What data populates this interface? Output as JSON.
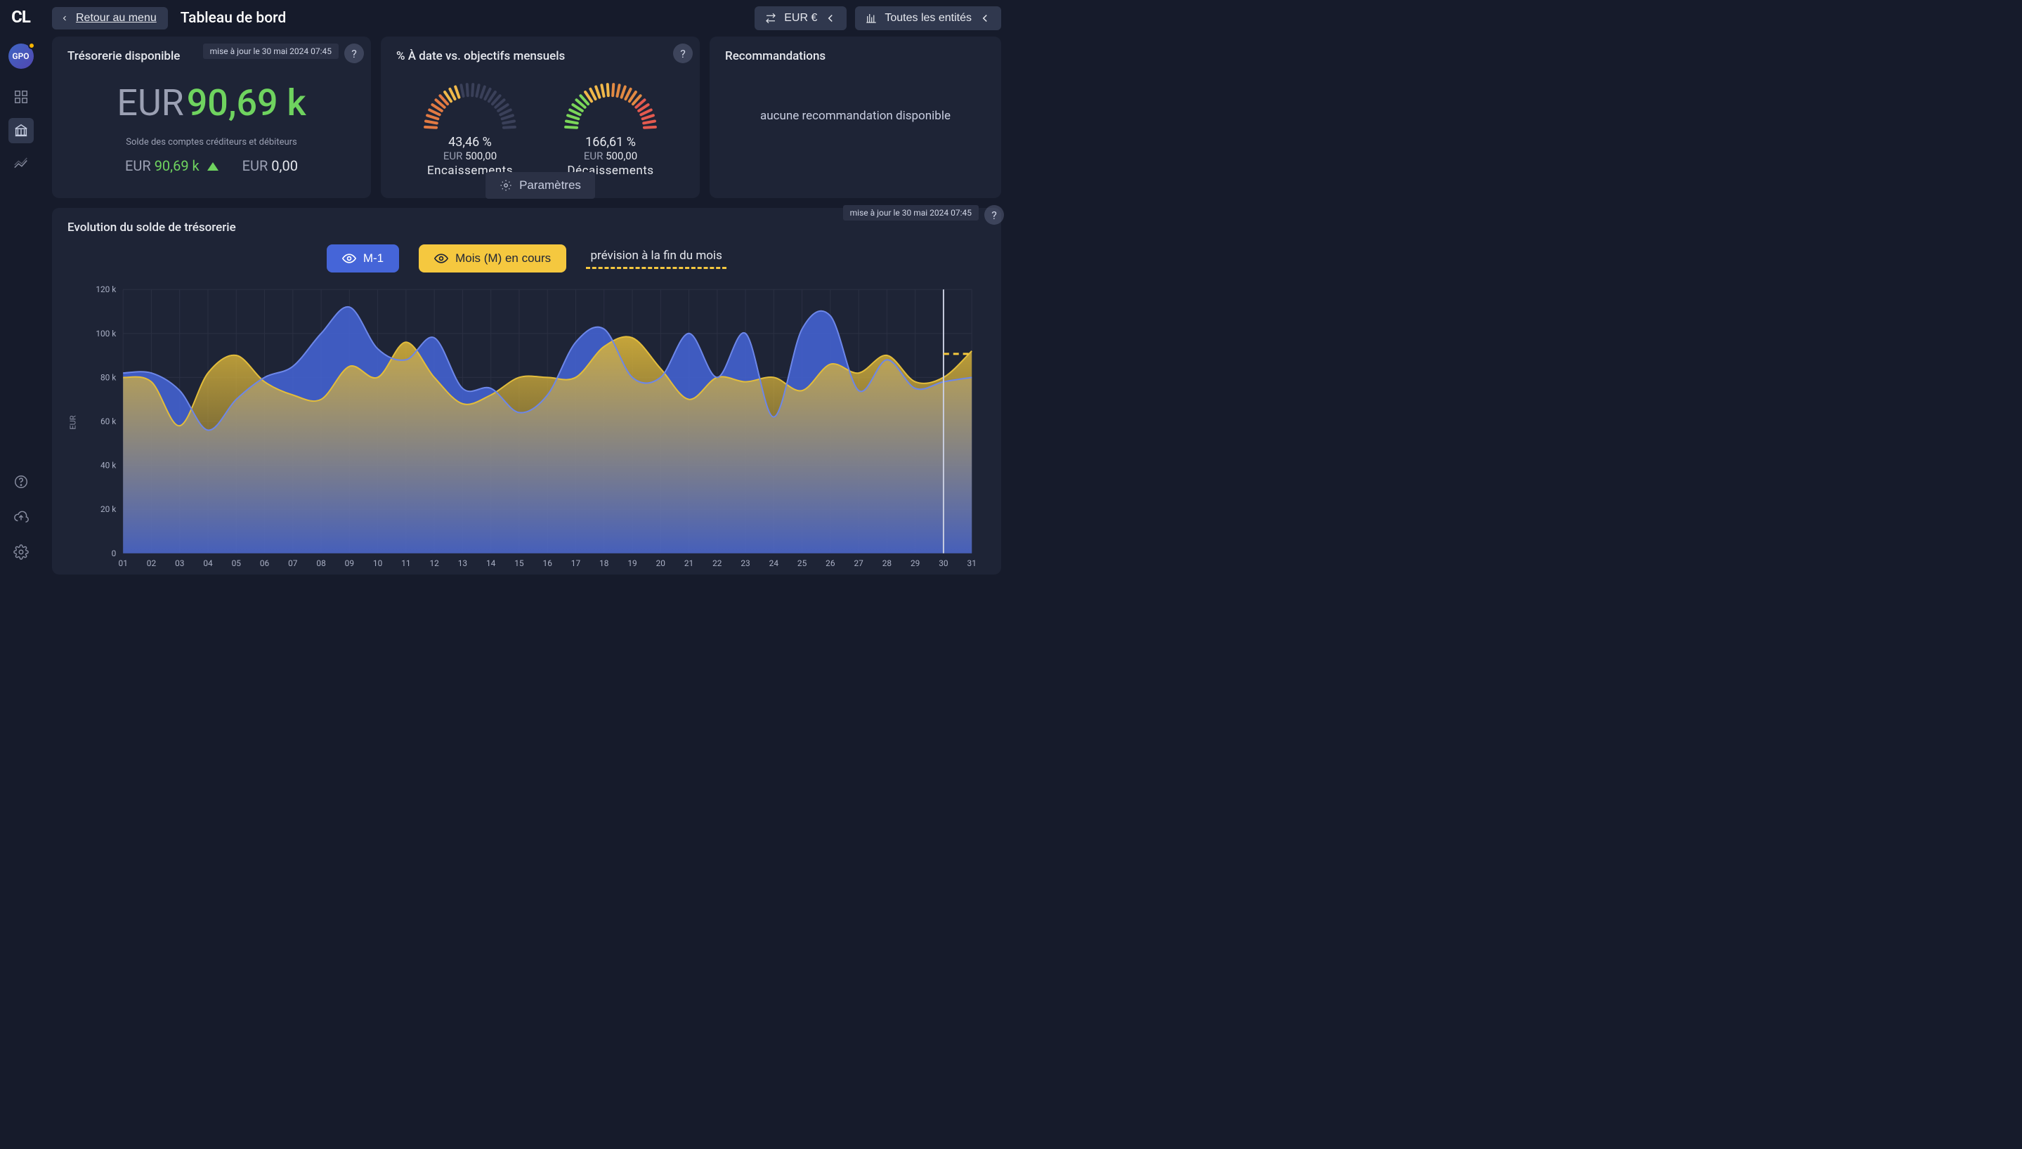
{
  "brand": "CL",
  "user_avatar": "GPO",
  "nav": {
    "back_label": "Retour au menu"
  },
  "page_title": "Tableau de bord",
  "selectors": {
    "currency_label": "EUR €",
    "entities_label": "Toutes les entités"
  },
  "updated_tip": "mise à jour le 30 mai 2024 07:45",
  "treasury": {
    "title": "Trésorerie disponible",
    "currency": "EUR",
    "amount_display": "90,69 k",
    "subtitle": "Solde des comptes créditeurs et débiteurs",
    "positive_label_curr": "EUR",
    "positive_value": "90,69 k",
    "negative_label_curr": "EUR",
    "negative_value": "0,00"
  },
  "gauges": {
    "title": "% À date vs. objectifs mensuels",
    "in": {
      "pct": "43,46 %",
      "amt_curr": "EUR",
      "amt": "500,00",
      "label": "Encaissements",
      "ratio": 0.4346
    },
    "out": {
      "pct": "166,61 %",
      "amt_curr": "EUR",
      "amt": "500,00",
      "label": "Décaissements",
      "ratio": 1.6661
    },
    "params_label": "Paramètres"
  },
  "reco": {
    "title": "Recommandations",
    "empty": "aucune recommandation disponible"
  },
  "chart": {
    "title": "Evolution du solde de trésorerie",
    "legend_m1": "M-1",
    "legend_m": "Mois (M) en cours",
    "legend_forecast": "prévision à la fin du mois",
    "y_axis_label": "EUR"
  },
  "chart_data": {
    "type": "area",
    "xlabel": "",
    "ylabel": "EUR",
    "ylim": [
      0,
      120000
    ],
    "y_ticks": [
      0,
      20000,
      40000,
      60000,
      80000,
      100000,
      120000
    ],
    "y_tick_labels": [
      "0",
      "20 k",
      "40 k",
      "60 k",
      "80 k",
      "100 k",
      "120 k"
    ],
    "x_days": [
      1,
      2,
      3,
      4,
      5,
      6,
      7,
      8,
      9,
      10,
      11,
      12,
      13,
      14,
      15,
      16,
      17,
      18,
      19,
      20,
      21,
      22,
      23,
      24,
      25,
      26,
      27,
      28,
      29,
      30,
      31
    ],
    "x_tick_labels": [
      "01",
      "02",
      "03",
      "04",
      "05",
      "06",
      "07",
      "08",
      "09",
      "10",
      "11",
      "12",
      "13",
      "14",
      "15",
      "16",
      "17",
      "18",
      "19",
      "20",
      "21",
      "22",
      "23",
      "24",
      "25",
      "26",
      "27",
      "28",
      "29",
      "30",
      "31"
    ],
    "series": [
      {
        "name": "M-1",
        "color": "#4565d8",
        "values": [
          82000,
          82000,
          74000,
          56000,
          70000,
          80000,
          85000,
          100000,
          112000,
          93000,
          88000,
          98000,
          75000,
          75000,
          64000,
          72000,
          96000,
          102000,
          80000,
          80000,
          100000,
          80000,
          100000,
          62000,
          102000,
          108000,
          74000,
          88000,
          75000,
          78000,
          80000
        ]
      },
      {
        "name": "Mois (M) en cours",
        "color": "#f5c83f",
        "values": [
          80000,
          78000,
          58000,
          82000,
          90000,
          78000,
          72000,
          70000,
          85000,
          80000,
          96000,
          80000,
          68000,
          72000,
          80000,
          80000,
          80000,
          94000,
          98000,
          84000,
          70000,
          80000,
          78000,
          80000,
          74000,
          86000,
          82000,
          90000,
          78000,
          80000,
          92000
        ]
      }
    ],
    "forecast_value": 90690,
    "forecast_cut_day": 30
  }
}
